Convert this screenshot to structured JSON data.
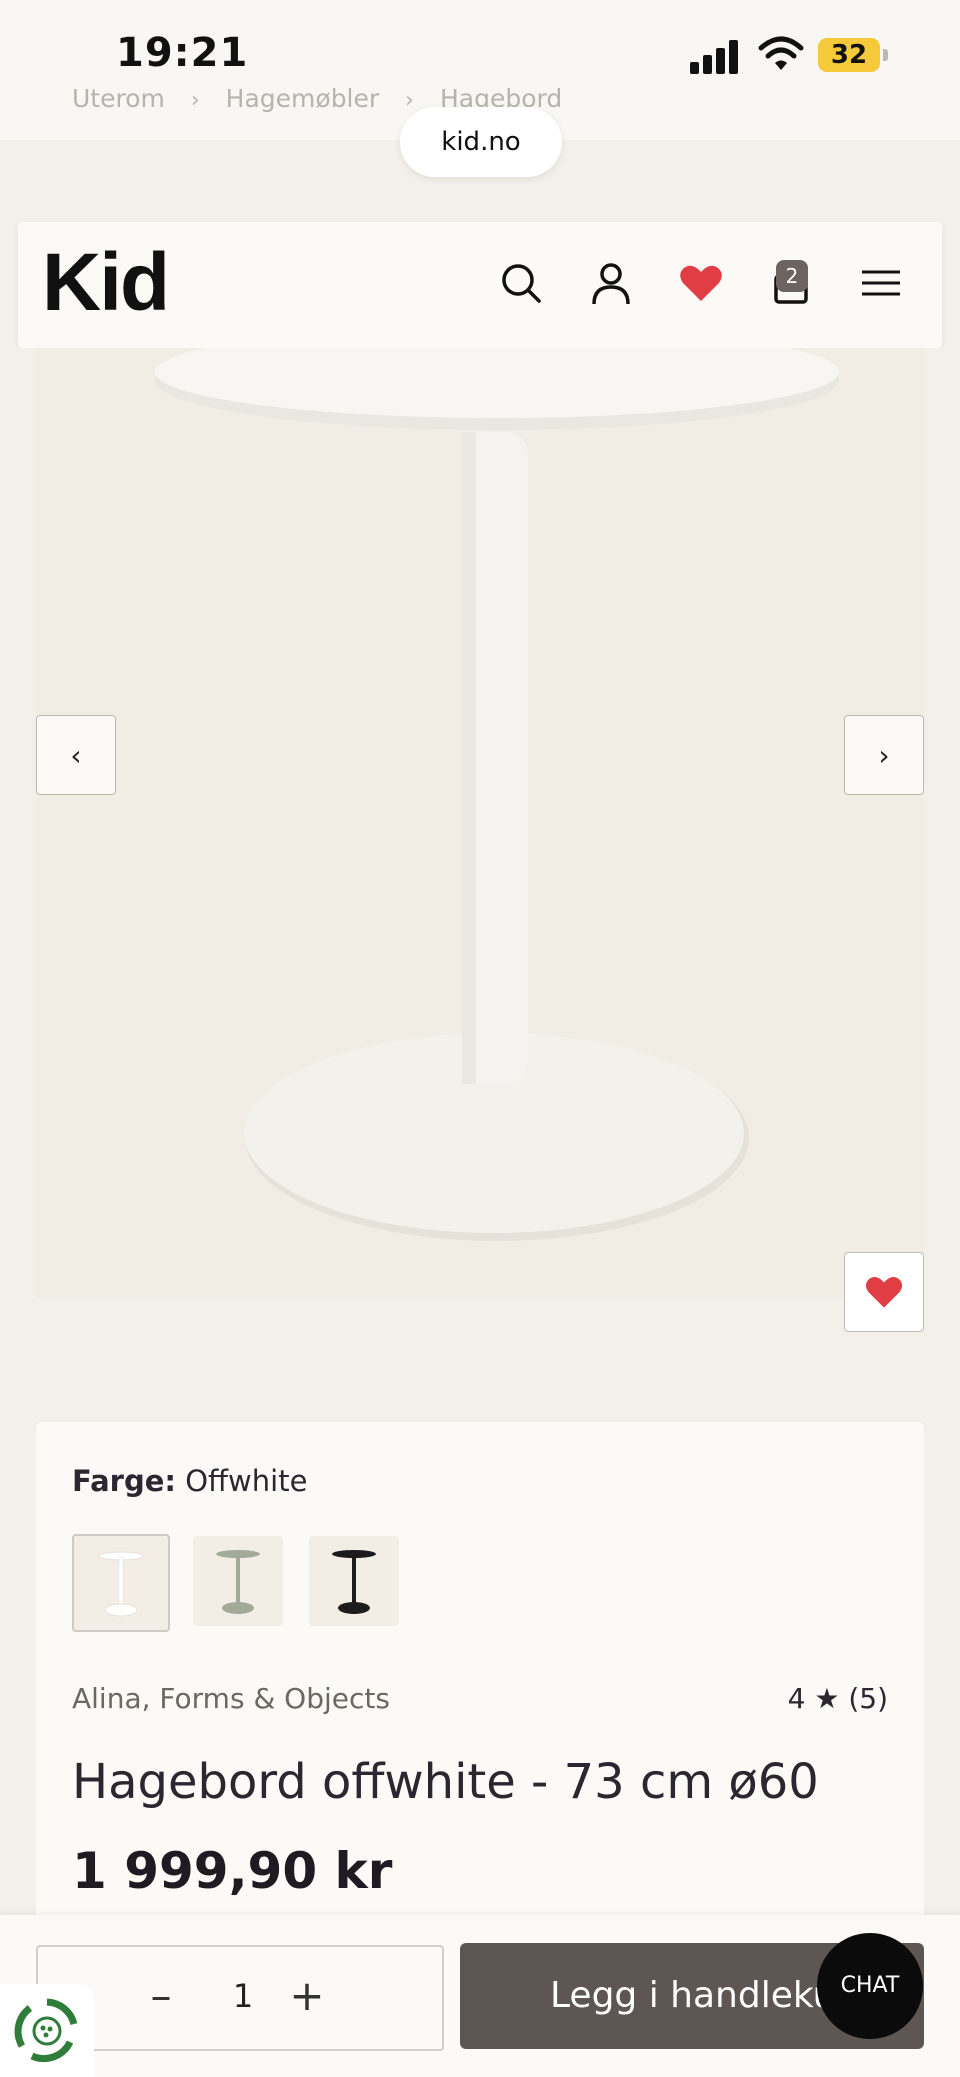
{
  "status_bar": {
    "time": "19:21",
    "battery": "32"
  },
  "breadcrumb": {
    "items": [
      "Uterom",
      "Hagemøbler",
      "Hagebord"
    ],
    "separator": "›"
  },
  "browser": {
    "url": "kid.no"
  },
  "header": {
    "logo": "Kid",
    "icons": [
      "search-icon",
      "account-icon",
      "wishlist-heart-icon",
      "cart-icon",
      "menu-icon"
    ],
    "cart_count": "2"
  },
  "gallery": {
    "prev_label": "‹",
    "next_label": "›"
  },
  "product": {
    "color_label": "Farge:",
    "color_value": "Offwhite",
    "swatches": [
      {
        "name": "offwhite",
        "color": "#ffffff",
        "selected": true
      },
      {
        "name": "green",
        "color": "#a3ab98",
        "selected": false
      },
      {
        "name": "black",
        "color": "#1c1c1c",
        "selected": false
      }
    ],
    "brand": "Alina, Forms & Objects",
    "rating": "4 ★ (5)",
    "title": "Hagebord offwhite - 73 cm ø60",
    "price": "1 999,90 kr"
  },
  "purchase": {
    "minus": "–",
    "quantity": "1",
    "plus": "+",
    "add_to_cart": "Legg i handlekurv",
    "chat": "CHAT"
  },
  "colors": {
    "accent_heart": "#e03d45",
    "add_button": "#5e5653",
    "page_bg": "#f3f0e9"
  }
}
